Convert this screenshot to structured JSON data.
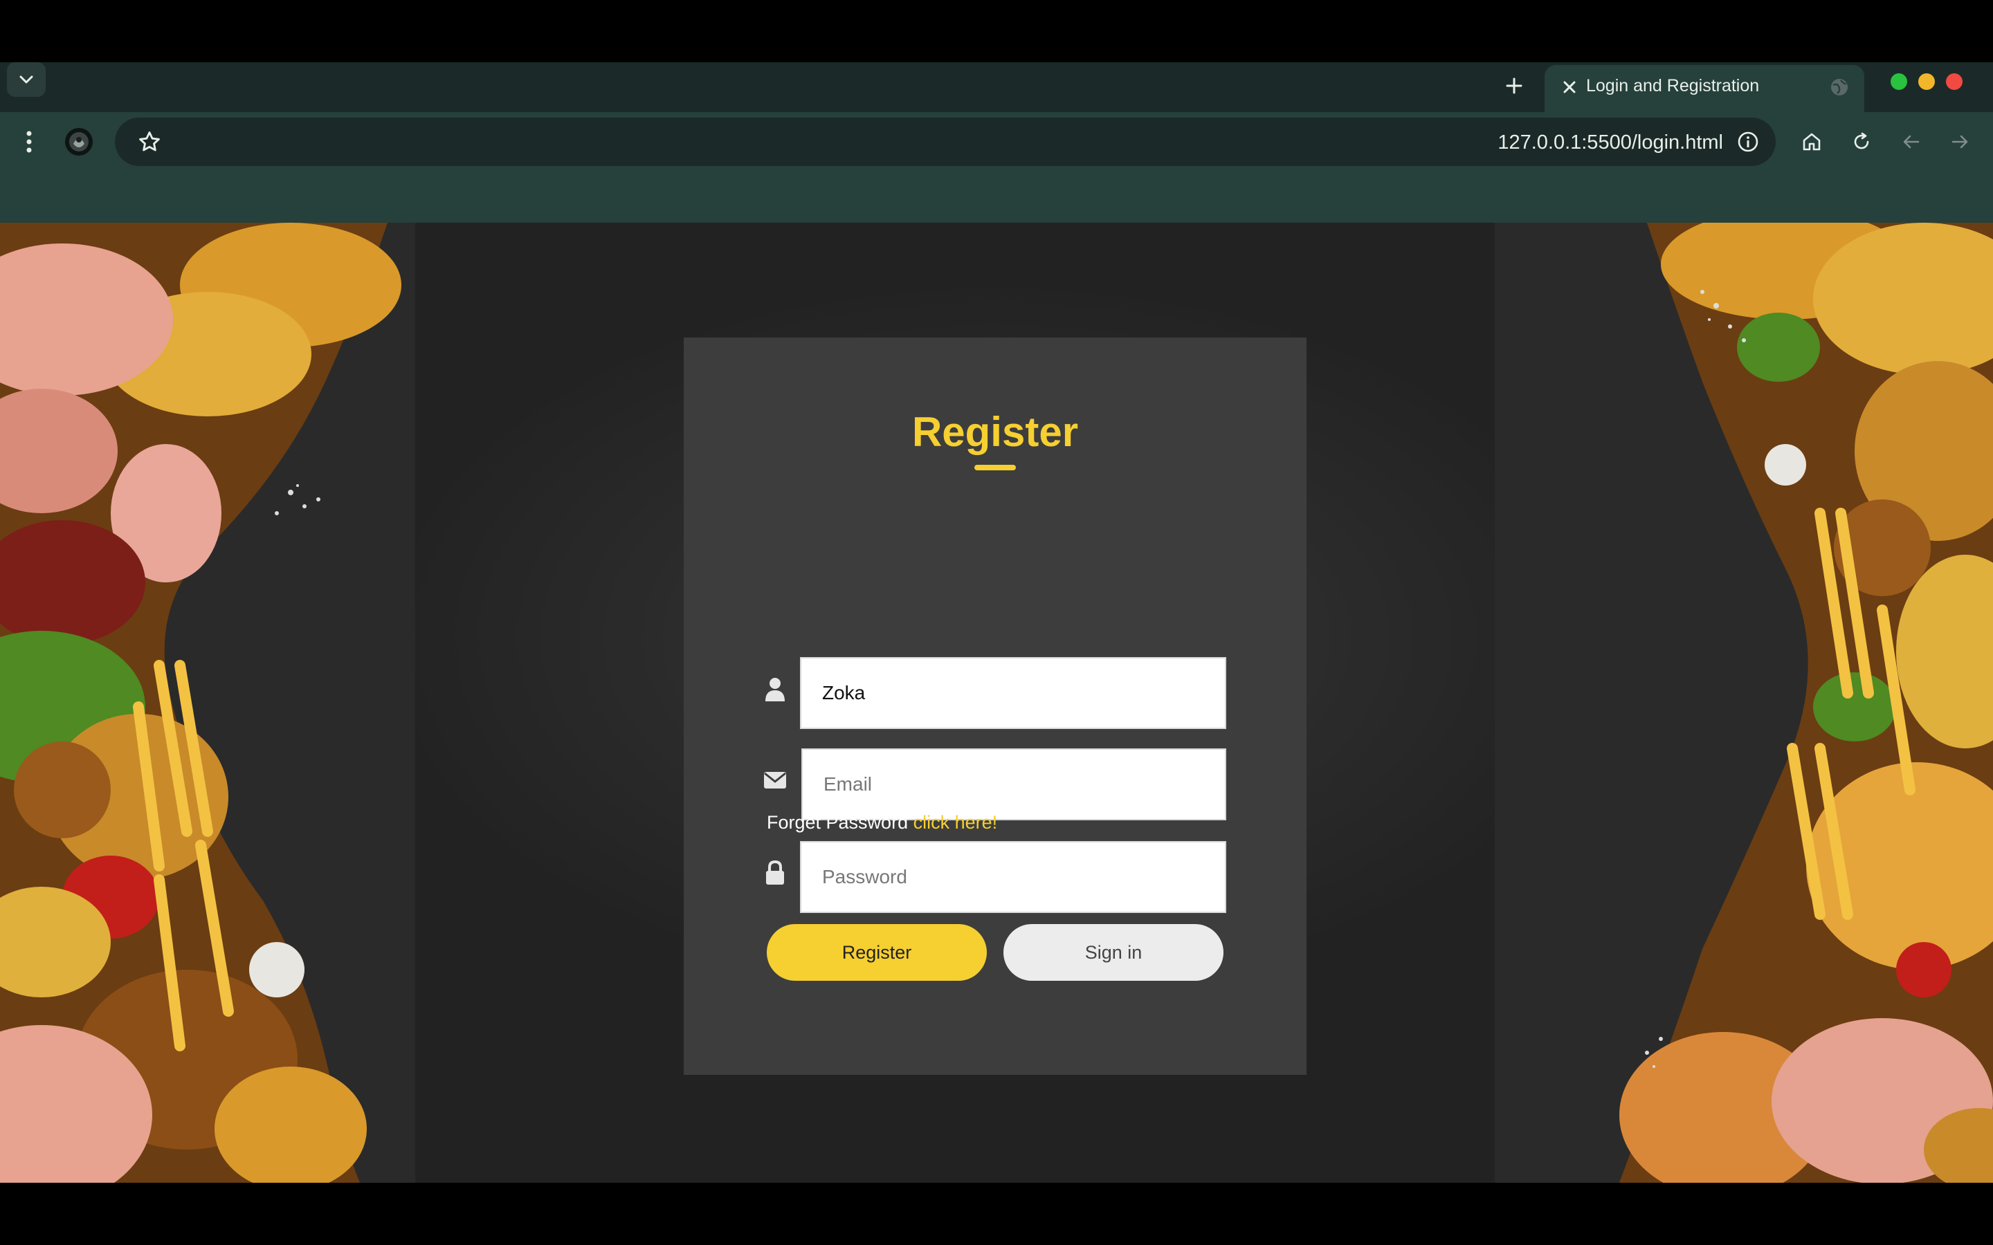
{
  "browser": {
    "tab_title": "Login and Registration",
    "url": "127.0.0.1:5500/login.html",
    "icons": {
      "tab_list": "chevron-down-icon",
      "new_tab": "plus-icon",
      "tab_close": "close-icon",
      "tab_favicon": "globe-icon",
      "menu": "more-vertical-icon",
      "profile": "avatar",
      "bookmark": "star-icon",
      "site_info": "info-icon",
      "home": "home-icon",
      "reload": "reload-icon",
      "back": "arrow-left-icon",
      "forward": "arrow-right-icon"
    },
    "window_controls": [
      "#29c33f",
      "#f2b62a",
      "#f04a43"
    ]
  },
  "form": {
    "title": "Register",
    "name_value": "Zoka",
    "email_placeholder": "Email",
    "password_placeholder": "Password",
    "forget_text": "Forget Password",
    "forget_link": "click here!",
    "register_label": "Register",
    "signin_label": "Sign in",
    "icons": {
      "name": "user-icon",
      "email": "envelope-icon",
      "password": "lock-icon"
    }
  },
  "colors": {
    "accent": "#f6cf31",
    "card_bg": "#3d3d3d",
    "chrome_bg": "#26403c"
  }
}
